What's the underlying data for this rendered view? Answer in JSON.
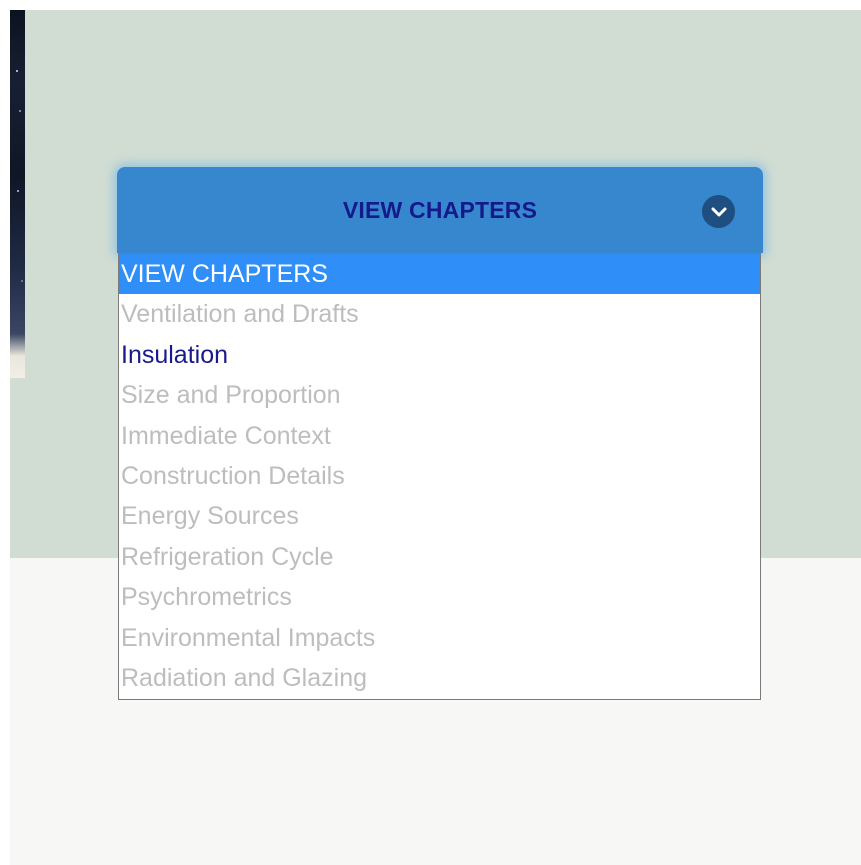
{
  "chapter_select": {
    "label": "VIEW CHAPTERS",
    "icon": "chevron-down-icon",
    "colors": {
      "button_bg": "#3787cf",
      "button_text": "#141a8a",
      "chevron_bg": "#1f4e80",
      "selected_bg": "#2f8ef7",
      "enabled_text": "#1a1a8a",
      "disabled_text": "#bdbdbd"
    },
    "options": [
      {
        "label": "VIEW CHAPTERS",
        "state": "selected"
      },
      {
        "label": "Ventilation and Drafts",
        "state": "disabled"
      },
      {
        "label": "Insulation",
        "state": "enabled"
      },
      {
        "label": "Size and Proportion",
        "state": "disabled"
      },
      {
        "label": "Immediate Context",
        "state": "disabled"
      },
      {
        "label": "Construction Details",
        "state": "disabled"
      },
      {
        "label": "Energy Sources",
        "state": "disabled"
      },
      {
        "label": "Refrigeration Cycle",
        "state": "disabled"
      },
      {
        "label": "Psychrometrics",
        "state": "disabled"
      },
      {
        "label": "Environmental Impacts",
        "state": "disabled"
      },
      {
        "label": "Radiation and Glazing",
        "state": "disabled"
      }
    ]
  }
}
